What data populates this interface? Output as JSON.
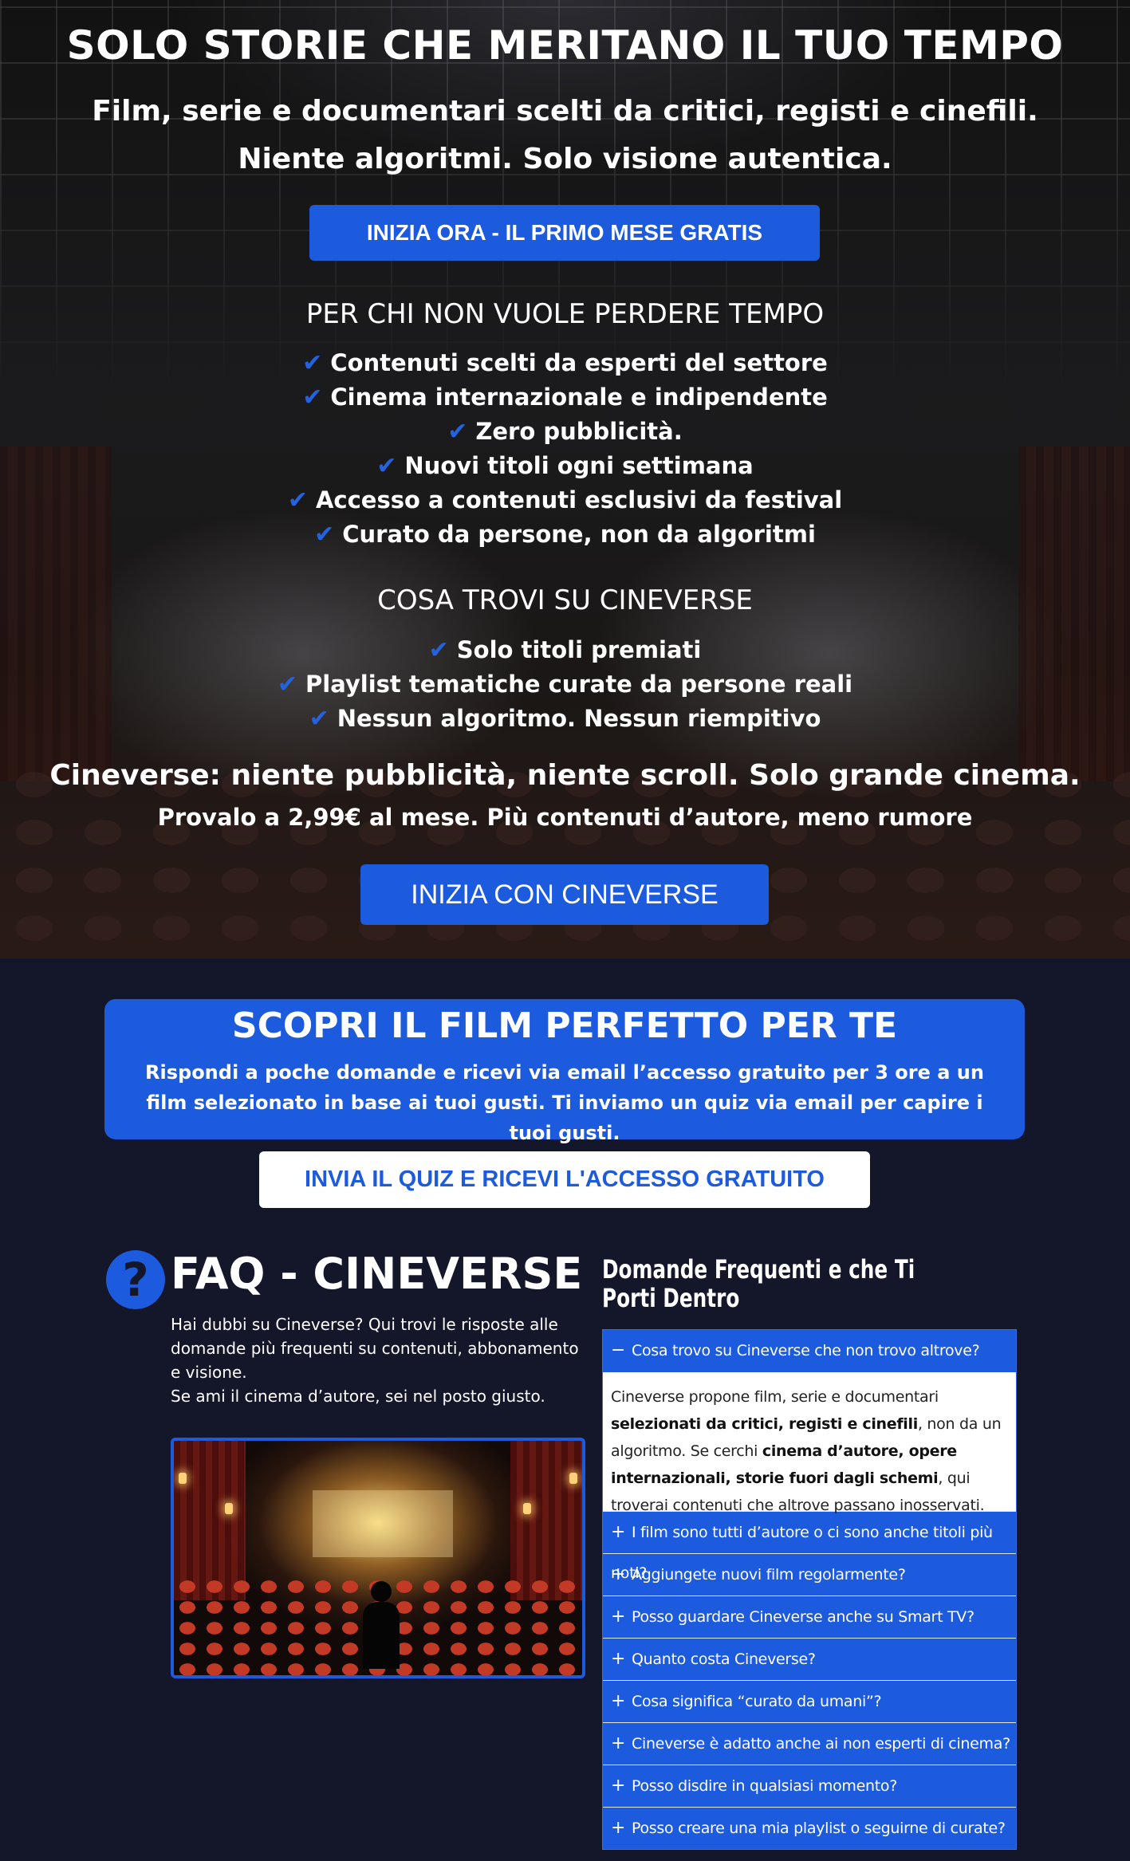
{
  "hero": {
    "title": "SOLO STORIE CHE MERITANO IL TUO TEMPO",
    "subtitle_line1": "Film, serie e documentari scelti da critici, registi e cinefili.",
    "subtitle_line2": "Niente algoritmi. Solo visione autentica.",
    "cta_top": "INIZIA ORA - IL PRIMO MESE GRATIS",
    "section1_title": "PER CHI NON VUOLE PERDERE TEMPO",
    "section1_items": [
      "Contenuti scelti da esperti del settore",
      "Cinema internazionale e indipendente",
      "Zero pubblicità.",
      "Nuovi titoli ogni settimana",
      "Accesso a contenuti esclusivi da festival",
      "Curato da persone, non da algoritmi"
    ],
    "section2_title": "COSA TROVI SU CINEVERSE",
    "section2_items": [
      "Solo titoli premiati",
      "Playlist tematiche curate da persone reali",
      "Nessun algoritmo. Nessun riempitivo"
    ],
    "tagline": "Cineverse: niente pubblicità, niente scroll. Solo grande cinema.",
    "price_line": "Provalo a 2,99€ al mese. Più contenuti d’autore, meno rumore",
    "cta_bottom": "INIZIA CON CINEVERSE",
    "check_glyph": "✔"
  },
  "quiz": {
    "title": "SCOPRI IL FILM PERFETTO PER TE",
    "text": "Rispondi a poche domande e ricevi via email l’accesso gratuito per 3 ore a un film selezionato in base ai tuoi gusti. Ti inviamo un quiz via email per capire i tuoi gusti.",
    "button": "INVIA IL QUIZ E RICEVI L'ACCESSO GRATUITO"
  },
  "faq": {
    "icon_glyph": "?",
    "title": "FAQ - CINEVERSE",
    "intro_line1": "Hai dubbi su Cineverse? Qui trovi le risposte alle domande più frequenti su contenuti, abbonamento e visione.",
    "intro_line2": "Se ami il cinema d’autore, sei nel posto giusto.",
    "heading": "Domande Frequenti e che Ti Porti Dentro",
    "open_item": {
      "sign": "−",
      "question": "Cosa trovo su Cineverse che non trovo altrove?",
      "answer_parts": [
        "Cineverse propone film, serie e documentari ",
        "selezionati da critici, registi e cinefili",
        ", non da un algoritmo. Se cerchi ",
        "cinema d’autore, opere internazionali, storie fuori dagli schemi",
        ", qui troverai contenuti che altrove passano inosservati."
      ]
    },
    "closed_sign": "+",
    "closed_items": [
      "I film sono tutti d’autore o ci sono anche titoli più noti?",
      "Aggiungete nuovi film regolarmente?",
      "Posso guardare Cineverse anche su Smart TV?",
      "Quanto costa Cineverse?",
      "Cosa significa “curato da umani”?",
      "Cineverse è adatto anche ai non esperti di cinema?",
      "Posso disdire in qualsiasi momento?",
      "Posso creare una mia playlist o seguirne di curate?"
    ]
  },
  "colors": {
    "accent": "#1c5ade",
    "background": "#14162a",
    "check": "#2462e0"
  }
}
